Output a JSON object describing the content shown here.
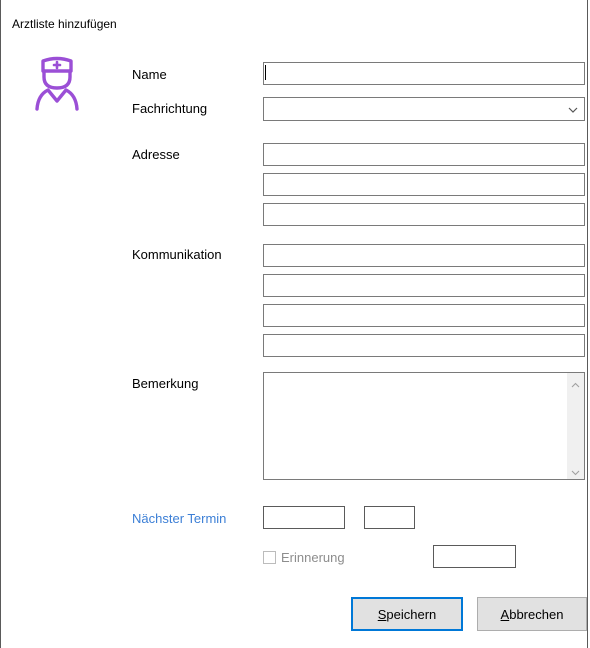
{
  "window": {
    "title": "Arztliste hinzufügen"
  },
  "icons": {
    "doctor": "doctor-nurse-icon",
    "dropdown": "chevron-down-icon",
    "scroll_up": "chevron-up-icon",
    "scroll_down": "chevron-down-icon",
    "accent_color": "#9b4fd6"
  },
  "form": {
    "name_label": "Name",
    "name_value": "",
    "specialty_label": "Fachrichtung",
    "specialty_value": "",
    "address_label": "Adresse",
    "address_lines": [
      "",
      "",
      ""
    ],
    "communication_label": "Kommunikation",
    "communication_lines": [
      "",
      "",
      "",
      ""
    ],
    "remark_label": "Bemerkung",
    "remark_value": "",
    "next_appointment_label": "Nächster Termin",
    "next_appointment_date": "",
    "next_appointment_time": "",
    "reminder_label": "Erinnerung",
    "reminder_checked": false,
    "reminder_value": ""
  },
  "buttons": {
    "save_mnemonic": "S",
    "save_rest": "peichern",
    "cancel_mnemonic": "A",
    "cancel_rest": "bbrechen"
  },
  "colors": {
    "link_label": "#3c7fd6",
    "default_button_border": "#0078d7",
    "disabled_text": "#8d8d8d"
  }
}
